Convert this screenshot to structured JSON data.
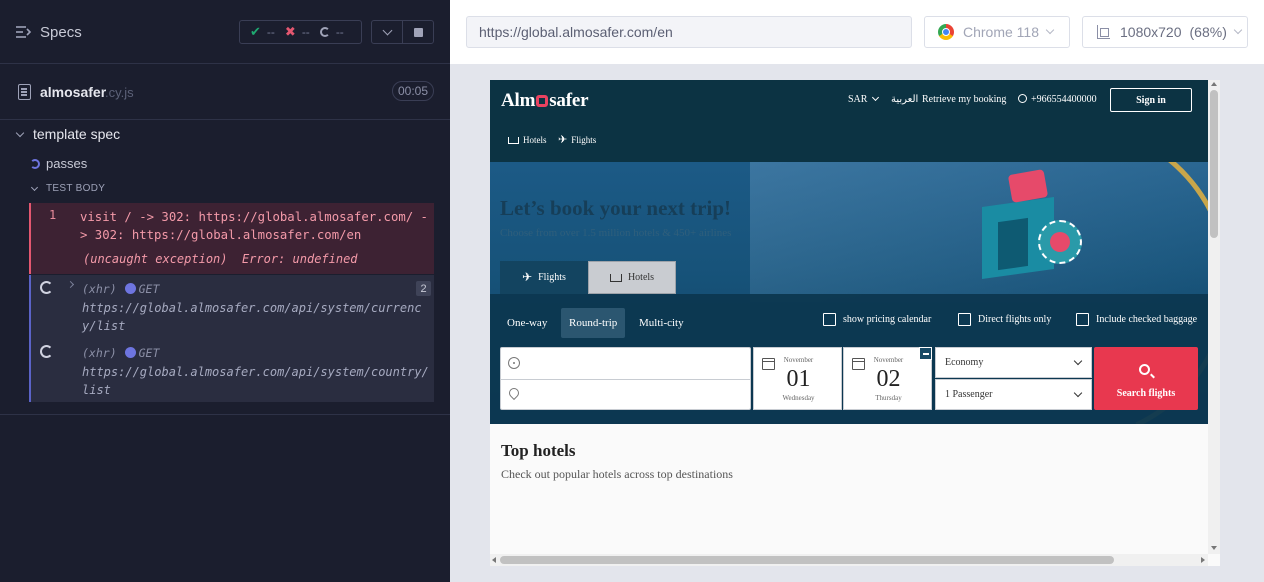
{
  "runner": {
    "header_title": "Specs",
    "stats": {
      "passed": "--",
      "failed": "--",
      "pending": "--"
    },
    "file": {
      "name": "almosafer",
      "ext": ".cy.js",
      "duration": "00:05"
    },
    "suite": "template spec",
    "test": "passes",
    "body_label": "TEST BODY",
    "commands": [
      {
        "num": "1",
        "text": "visit / -> 302: https://global.almosafer.com/ -> 302: https://global.almosafer.com/en",
        "exception": "(uncaught exception)  Error: undefined"
      }
    ],
    "xhr": [
      {
        "type": "(xhr)",
        "method": "GET",
        "url": "https://global.almosafer.com/api/system/currency/list",
        "count": "2"
      },
      {
        "type": "(xhr)",
        "method": "GET",
        "url": "https://global.almosafer.com/api/system/country/list"
      }
    ]
  },
  "browser": {
    "url": "https://global.almosafer.com/en",
    "name": "Chrome 118",
    "viewport": "1080x720",
    "zoom": "(68%)"
  },
  "site": {
    "logo_a": "Alm",
    "logo_b": "safer",
    "currency": "SAR",
    "arabic": "العربية",
    "retrieve": "Retrieve my booking",
    "phone": "+966554400000",
    "signin": "Sign in",
    "nav_hotels": "Hotels",
    "nav_flights": "Flights",
    "hero_title": "Let’s book your next trip!",
    "hero_sub": "Choose from over 1.5 million hotels & 450+ airlines",
    "tab_flights": "Flights",
    "tab_hotels": "Hotels",
    "trip_oneway": "One-way",
    "trip_round": "Round-trip",
    "trip_multi": "Multi-city",
    "chk_pricing": "show pricing calendar",
    "chk_direct": "Direct flights only",
    "chk_baggage": "Include checked baggage",
    "depart": {
      "month": "November",
      "day": "01",
      "weekday": "Wednesday"
    },
    "return": {
      "month": "November",
      "day": "02",
      "weekday": "Thursday"
    },
    "cabin": "Economy",
    "passengers": "1 Passenger",
    "search_btn": "Search flights",
    "top_hotels": "Top hotels",
    "top_hotels_sub": "Check out popular hotels across top destinations"
  }
}
